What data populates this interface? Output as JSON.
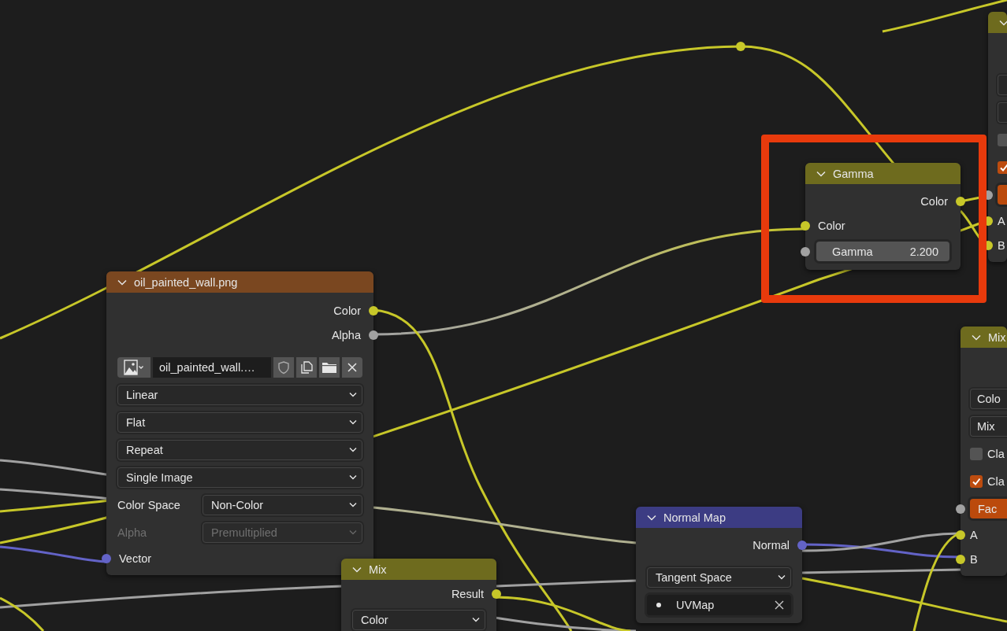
{
  "nodes": [
    {
      "color": "#6e6b1e",
      "highlighted": false,
      "rows": [
        {
          "kind": "dropdown"
        },
        {
          "kind": "dropdown"
        },
        {
          "kind": "checkbox",
          "checked": false
        },
        {
          "kind": "checkbox",
          "checked": true
        },
        {
          "kind": "factor",
          "color": "#a1a1a1"
        },
        {
          "kind": "input",
          "label": "A",
          "color": "#c7c729"
        },
        {
          "kind": "input",
          "label": "B",
          "color": "#c7c729"
        }
      ]
    },
    {
      "title": "Gamma",
      "color": "#6e6b1e",
      "highlighted": true,
      "rows": [
        {
          "kind": "output",
          "label": "Color",
          "color": "#c7c729"
        },
        {
          "kind": "input",
          "label": "Color",
          "color": "#c7c729"
        },
        {
          "kind": "value",
          "label": "Gamma",
          "value": "2.200",
          "color": "#a1a1a1"
        }
      ]
    },
    {
      "title": "oil_painted_wall.png",
      "color": "#7a4720",
      "highlighted": false,
      "rows": [
        {
          "kind": "output",
          "label": "Color",
          "color": "#c7c729"
        },
        {
          "kind": "output",
          "label": "Alpha",
          "color": "#a1a1a1"
        },
        {
          "kind": "image",
          "value": "oil_painted_wall.…"
        },
        {
          "kind": "dropdown",
          "value": "Linear",
          "disabled": false
        },
        {
          "kind": "dropdown",
          "value": "Flat",
          "disabled": false
        },
        {
          "kind": "dropdown",
          "value": "Repeat",
          "disabled": false
        },
        {
          "kind": "dropdown",
          "value": "Single Image",
          "disabled": false
        },
        {
          "kind": "dropdown",
          "label": "Color Space",
          "value": "Non-Color",
          "disabled": false
        },
        {
          "kind": "dropdown",
          "label": "Alpha",
          "value": "Premultiplied",
          "disabled": true
        },
        {
          "kind": "input",
          "label": "Vector",
          "color": "#6363c7"
        }
      ]
    },
    {
      "title": "Mix",
      "color": "#6e6b1e",
      "highlighted": false,
      "rows": [
        {
          "kind": "dropdown",
          "value": "Colo",
          "disabled": false
        },
        {
          "kind": "dropdown",
          "value": "Mix",
          "disabled": false
        },
        {
          "kind": "checkbox",
          "label": "Cla",
          "checked": false
        },
        {
          "kind": "checkbox",
          "label": "Cla",
          "checked": true
        },
        {
          "kind": "factor",
          "label": "Fac",
          "color": "#a1a1a1"
        },
        {
          "kind": "input",
          "label": "A",
          "color": "#c7c729"
        },
        {
          "kind": "input",
          "label": "B",
          "color": "#c7c729"
        }
      ]
    },
    {
      "title": "Normal Map",
      "color": "#3c3c83",
      "highlighted": false,
      "rows": [
        {
          "kind": "output",
          "label": "Normal",
          "color": "#6363c7"
        },
        {
          "kind": "dropdown",
          "value": "Tangent Space",
          "disabled": false
        },
        {
          "kind": "search",
          "value": "UVMap"
        }
      ]
    },
    {
      "title": "Mix",
      "color": "#6e6b1e",
      "highlighted": false,
      "rows": [
        {
          "kind": "output",
          "label": "Result",
          "color": "#c7c729"
        },
        {
          "kind": "dropdown",
          "value": "Color",
          "disabled": false
        }
      ]
    }
  ]
}
